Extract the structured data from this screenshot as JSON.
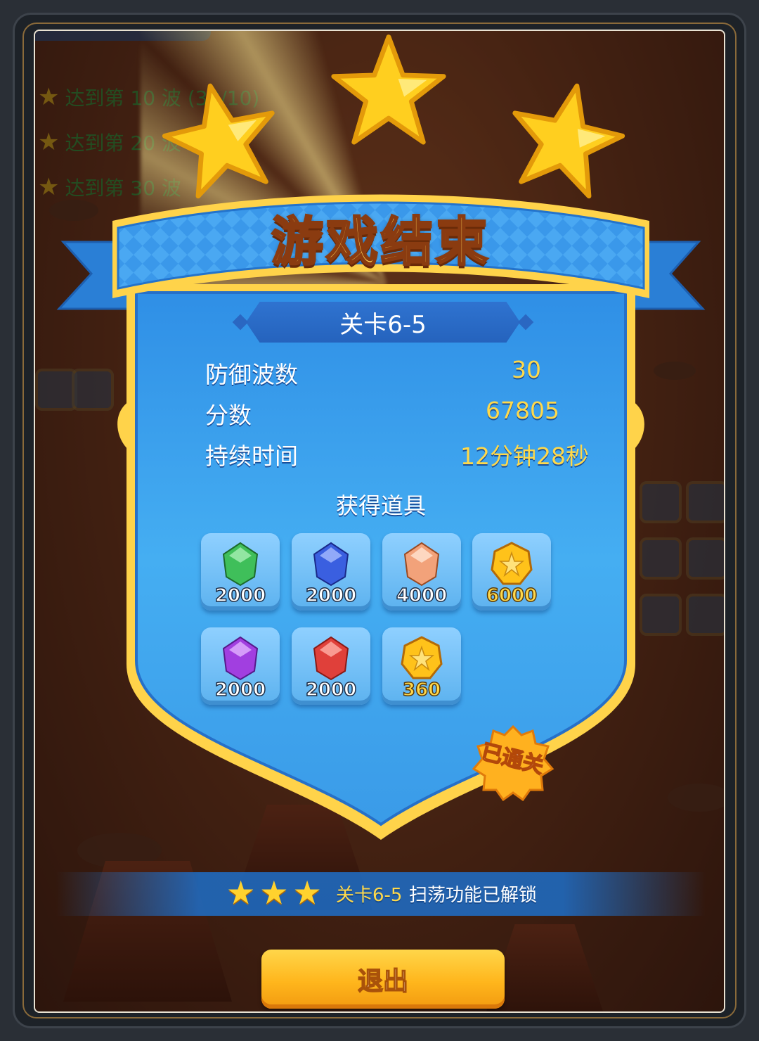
{
  "background": {
    "objectives": [
      {
        "text": "达到第 10 波 (30/10)"
      },
      {
        "text": "达到第 20 波"
      },
      {
        "text": "达到第 30 波"
      }
    ]
  },
  "result": {
    "title": "游戏结束",
    "level": "关卡6-5",
    "stats": [
      {
        "label": "防御波数",
        "value": "30"
      },
      {
        "label": "分数",
        "value": "67805"
      },
      {
        "label": "持续时间",
        "value": "12分钟28秒"
      }
    ],
    "items_title": "获得道具",
    "items": [
      {
        "icon": "green-gem-icon",
        "count": "2000",
        "color": "#3fbf5a"
      },
      {
        "icon": "blue-gem-icon",
        "count": "2000",
        "color": "#3a5fe0"
      },
      {
        "icon": "orange-gem-icon",
        "count": "4000",
        "color": "#f2a27a"
      },
      {
        "icon": "gold-coin-icon",
        "count": "6000",
        "color": "#ffc21a"
      },
      {
        "icon": "purple-gem-icon",
        "count": "2000",
        "color": "#a13fe0"
      },
      {
        "icon": "red-gem-icon",
        "count": "2000",
        "color": "#e0403a"
      },
      {
        "icon": "gold-coin-icon",
        "count": "360",
        "color": "#ffc21a"
      }
    ],
    "cleared_badge": "已通关",
    "stars_earned": 3
  },
  "unlock": {
    "level": "关卡6-5",
    "text": "扫荡功能已解锁"
  },
  "exit_button": "退出",
  "colors": {
    "accent_gold": "#ffd94a",
    "panel_blue": "#3ea0ee",
    "button_orange": "#ffb61c"
  }
}
